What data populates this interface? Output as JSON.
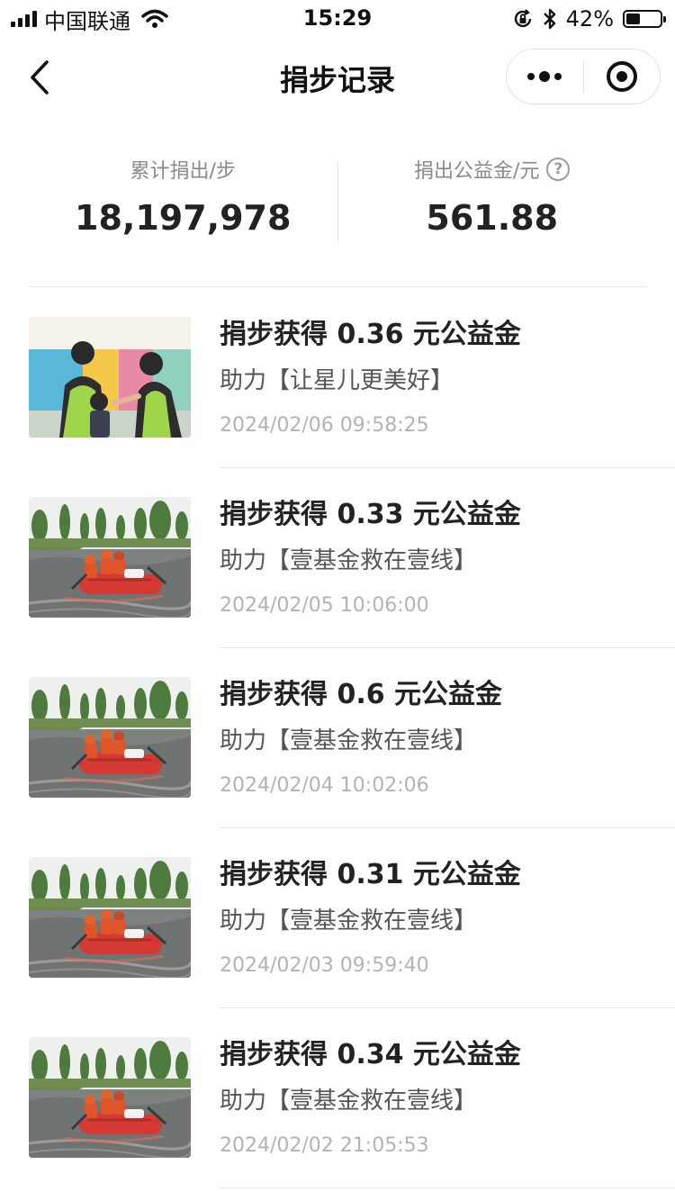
{
  "status_bar": {
    "carrier": "中国联通",
    "time": "15:29",
    "battery_percent": "42%",
    "battery_level": 0.42
  },
  "nav": {
    "title": "捐步记录"
  },
  "summary": {
    "steps_label": "累计捐出/步",
    "steps_value": "18,197,978",
    "money_label": "捐出公益金/元",
    "money_value": "561.88"
  },
  "records": [
    {
      "title": "捐步获得 0.36 元公益金",
      "project": "助力【让星儿更美好】",
      "time": "2024/02/06 09:58:25",
      "image": "children-photo"
    },
    {
      "title": "捐步获得 0.33 元公益金",
      "project": "助力【壹基金救在壹线】",
      "time": "2024/02/05 10:06:00",
      "image": "rescue-boat-photo"
    },
    {
      "title": "捐步获得 0.6 元公益金",
      "project": "助力【壹基金救在壹线】",
      "time": "2024/02/04 10:02:06",
      "image": "rescue-boat-photo"
    },
    {
      "title": "捐步获得 0.31 元公益金",
      "project": "助力【壹基金救在壹线】",
      "time": "2024/02/03 09:59:40",
      "image": "rescue-boat-photo"
    },
    {
      "title": "捐步获得 0.34 元公益金",
      "project": "助力【壹基金救在壹线】",
      "time": "2024/02/02 21:05:53",
      "image": "rescue-boat-photo"
    }
  ]
}
